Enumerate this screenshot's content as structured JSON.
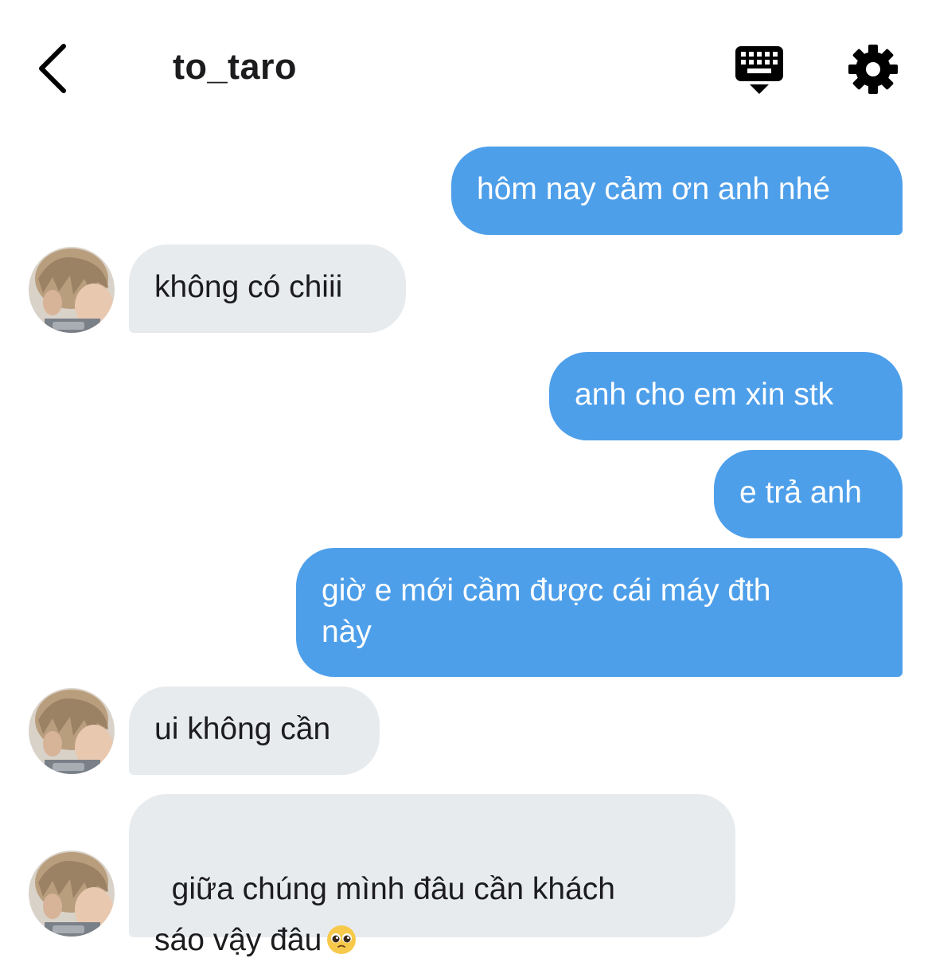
{
  "header": {
    "title": "to_taro",
    "back_icon": "chevron-left-icon",
    "keyboard_icon": "keyboard-icon",
    "settings_icon": "gear-icon"
  },
  "colors": {
    "sent_bubble": "#4e9fea",
    "received_bubble": "#e8ebee",
    "background": "#ffffff"
  },
  "messages": [
    {
      "direction": "sent",
      "text": "hôm nay cảm ơn anh nhé"
    },
    {
      "direction": "received",
      "text": "không có chiii"
    },
    {
      "direction": "sent",
      "text": "anh cho em xin stk"
    },
    {
      "direction": "sent",
      "text": "e trả anh"
    },
    {
      "direction": "sent",
      "text": "giờ e mới cầm được cái máy đth\nnày"
    },
    {
      "direction": "received",
      "text": "ui không cần"
    },
    {
      "direction": "received",
      "text": "giữa chúng mình đâu cần khách\nsáo vậy đâu",
      "emoji": "pleading-face-emoji"
    }
  ]
}
